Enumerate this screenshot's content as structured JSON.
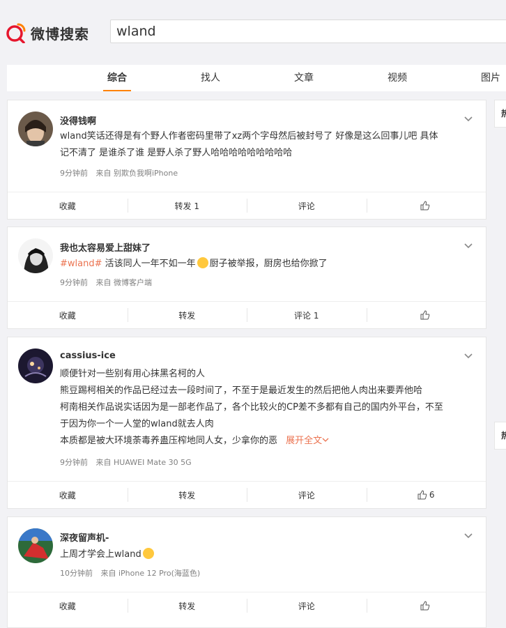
{
  "app": {
    "logo_text": "微博搜索"
  },
  "search": {
    "value": "wland"
  },
  "tabs": [
    {
      "label": "综合"
    },
    {
      "label": "找人"
    },
    {
      "label": "文章"
    },
    {
      "label": "视频"
    },
    {
      "label": "图片"
    }
  ],
  "side": {
    "label1": "热",
    "label2": "热"
  },
  "posts": [
    {
      "name": "没得钱啊",
      "text_lines": [
        "wland笑话还得是有个野人作者密码里带了xz两个字母然后被封号了 好像是这么回事儿吧 具体",
        "记不清了 是谁杀了谁 是野人杀了野人哈哈哈哈哈哈哈哈哈"
      ],
      "time": "9分钟前",
      "source": "来自 别欺负我啊iPhone",
      "actions": {
        "fav": "收藏",
        "repost": "转发 1",
        "comment": "评论",
        "like": ""
      }
    },
    {
      "name": "我也太容易爱上甜妹了",
      "hashtag": "#wland#",
      "text_a": "活该同人一年不如一年",
      "text_b": "厨子被举报，厨房也给你掀了",
      "time": "9分钟前",
      "source": "来自 微博客户端",
      "actions": {
        "fav": "收藏",
        "repost": "转发",
        "comment": "评论 1",
        "like": ""
      }
    },
    {
      "name": "cassius-ice",
      "text_lines": [
        "顺便针对一些别有用心抹黑名柯的人",
        "熊豆踢柯相关的作品已经过去一段时间了，不至于是最近发生的然后把他人肉出来要弄他哈",
        "柯南相关作品说实话因为是一部老作品了，各个比较火的CP差不多都有自己的国内外平台，不至",
        "于因为你一个一人堂的wland就去人肉",
        "本质都是被大环境荼毒养蛊压榨地同人女，少拿你的恶"
      ],
      "expand": "展开全文",
      "time": "9分钟前",
      "source": "来自 HUAWEI Mate 30 5G",
      "actions": {
        "fav": "收藏",
        "repost": "转发",
        "comment": "评论",
        "like": "6"
      }
    },
    {
      "name": "深夜留声机-",
      "text": "上周才学会上wland",
      "time": "10分钟前",
      "source": "来自 iPhone 12 Pro(海蓝色)",
      "actions": {
        "fav": "收藏",
        "repost": "转发",
        "comment": "评论",
        "like": ""
      }
    }
  ],
  "colors": {
    "accent": "#ff8200",
    "link": "#eb7350",
    "meta": "#808080"
  }
}
